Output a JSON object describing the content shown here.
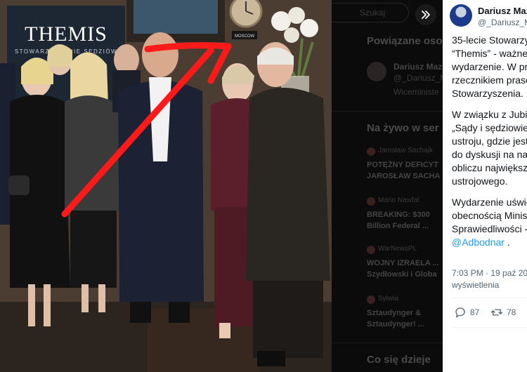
{
  "photo": {
    "banner": {
      "title": "THEMIS",
      "subtitle": "STOWARZYSZENIE SĘDZIÓW"
    },
    "door_sign": "MOSCOW"
  },
  "background": {
    "search_placeholder": "Szukaj",
    "related_heading": "Powiązane osoby",
    "related_name": "Dariusz Maz",
    "related_handle": "@_Dariusz_M",
    "related_bio": "Wiceministe",
    "live_heading": "Na żywo w ser",
    "live_items": [
      {
        "author": "Jarosław Sachajk",
        "title1": "POTĘŻNY DEFICYT",
        "title2": "JAROSŁAW SACHA"
      },
      {
        "author": "Mario Nawfal",
        "title1": "BREAKING: $300",
        "title2": "Billion Federal ..."
      },
      {
        "author": "WarNewsPL",
        "title1": "WOJNY IZRAELA ...",
        "title2": "Szydłowski i Globa"
      },
      {
        "author": "Sylwia",
        "title1": "Sztaudynger &",
        "title2": "Sztaudynger! ..."
      }
    ],
    "happening_heading": "Co się dzieje"
  },
  "tweet": {
    "author_name": "Dariusz Maz",
    "author_handle": "@_Dariusz_M",
    "lines_p1": [
      "35-lecie Stowarzy",
      "“Themis” - ważne",
      "wydarzenie. W prz",
      "rzecznikiem praso",
      "Stowarzyszenia."
    ],
    "lines_p2": [
      "W związku z Jubile",
      "„Sądy i sędziowie",
      "ustroju, gdzie jest",
      "do dyskusji na naj",
      "obliczu największ",
      "ustrojowego."
    ],
    "lines_p3": [
      "Wydarzenie uświe",
      "obecnością Minis",
      "Sprawiedliwości -"
    ],
    "mention": "@Adbodnar",
    "mention_suffix": " .",
    "timestamp": "7:03 PM · 19 paź 202",
    "views_label": "wyświetlenia",
    "replies": "87",
    "reposts": "78"
  },
  "colors": {
    "accent": "#1d9bf0",
    "arrow": "#ff1a1a",
    "text_primary": "#0f1419",
    "text_secondary": "#536471"
  },
  "icons": {
    "nav": "forward-chevron-icon",
    "reply": "reply-bubble-icon",
    "repost": "repost-icon"
  }
}
